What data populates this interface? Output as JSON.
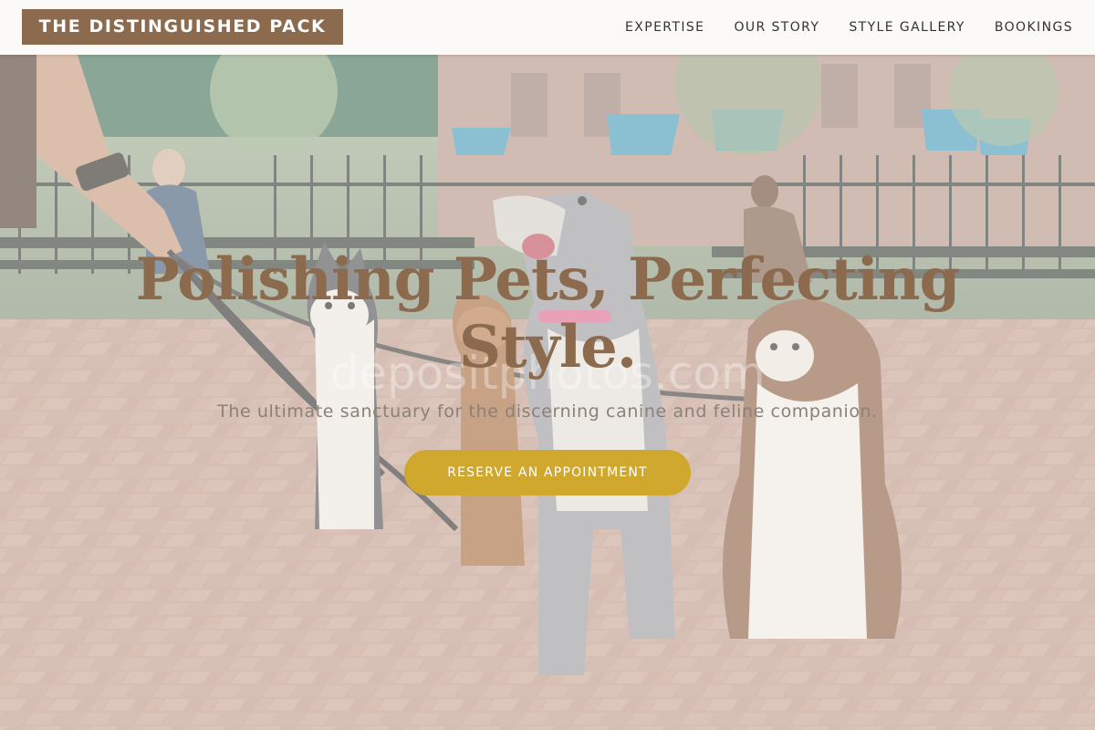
{
  "brand": {
    "name": "THE DISTINGUISHED PACK",
    "color": "#8b6a4e"
  },
  "nav": {
    "items": [
      {
        "label": "EXPERTISE"
      },
      {
        "label": "OUR STORY"
      },
      {
        "label": "STYLE GALLERY"
      },
      {
        "label": "BOOKINGS"
      }
    ]
  },
  "hero": {
    "title": "Polishing Pets, Perfecting Style.",
    "subtitle": "The ultimate sanctuary for the discerning canine and feline companion.",
    "cta_label": "RESERVE AN APPOINTMENT",
    "cta_color": "#cfa82d",
    "watermark": "depositphotos.com",
    "image_icon": "dogs-on-leash-photo"
  }
}
